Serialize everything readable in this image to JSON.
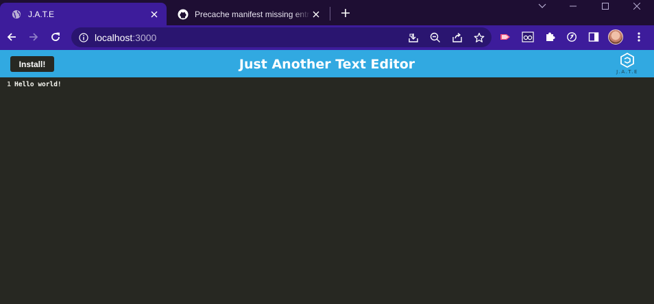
{
  "browser": {
    "tabs": [
      {
        "title": "J.A.T.E",
        "active": true
      },
      {
        "title": "Precache manifest missing entries",
        "active": false
      }
    ],
    "url": {
      "host": "localhost",
      "port": ":3000"
    }
  },
  "app": {
    "install_label": "Install!",
    "title": "Just Another Text Editor",
    "logo_text": "J.A.T.E"
  },
  "editor": {
    "lines": [
      {
        "number": "1",
        "text": "Hello world!"
      }
    ]
  },
  "colors": {
    "appbar": "#31a9e1",
    "editor_bg": "#272822",
    "browser_frame": "#3d1c9b"
  }
}
